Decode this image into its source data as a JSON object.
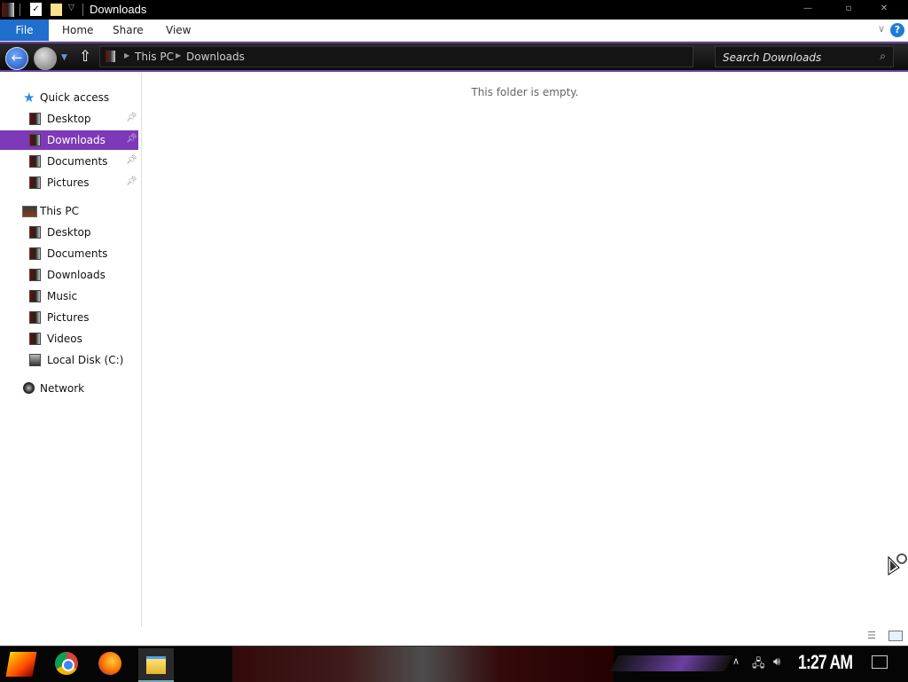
{
  "window": {
    "title": "Downloads",
    "quick_access_toolbar": [
      "properties-icon",
      "new-folder-icon",
      "customize-chevron-icon"
    ]
  },
  "ribbon": {
    "tabs": [
      "File",
      "Home",
      "Share",
      "View"
    ],
    "help_label": "?"
  },
  "nav": {
    "breadcrumb": [
      "This PC",
      "Downloads"
    ],
    "search_placeholder": "Search Downloads"
  },
  "sidebar": {
    "quick_access": {
      "label": "Quick access",
      "items": [
        {
          "label": "Desktop",
          "pinned": true
        },
        {
          "label": "Downloads",
          "pinned": true,
          "selected": true
        },
        {
          "label": "Documents",
          "pinned": true
        },
        {
          "label": "Pictures",
          "pinned": true
        }
      ]
    },
    "this_pc": {
      "label": "This PC",
      "items": [
        {
          "label": "Desktop"
        },
        {
          "label": "Documents"
        },
        {
          "label": "Downloads"
        },
        {
          "label": "Music"
        },
        {
          "label": "Pictures"
        },
        {
          "label": "Videos"
        },
        {
          "label": "Local Disk (C:)"
        }
      ]
    },
    "network": {
      "label": "Network"
    }
  },
  "content": {
    "empty_message": "This folder is empty."
  },
  "taskbar": {
    "apps": [
      "start-logo",
      "chrome-icon",
      "firefox-icon",
      "file-explorer-icon"
    ],
    "clock": "1:27 AM"
  },
  "colors": {
    "accent_purple": "#7d39b8",
    "file_tab_blue": "#1e6fce"
  }
}
